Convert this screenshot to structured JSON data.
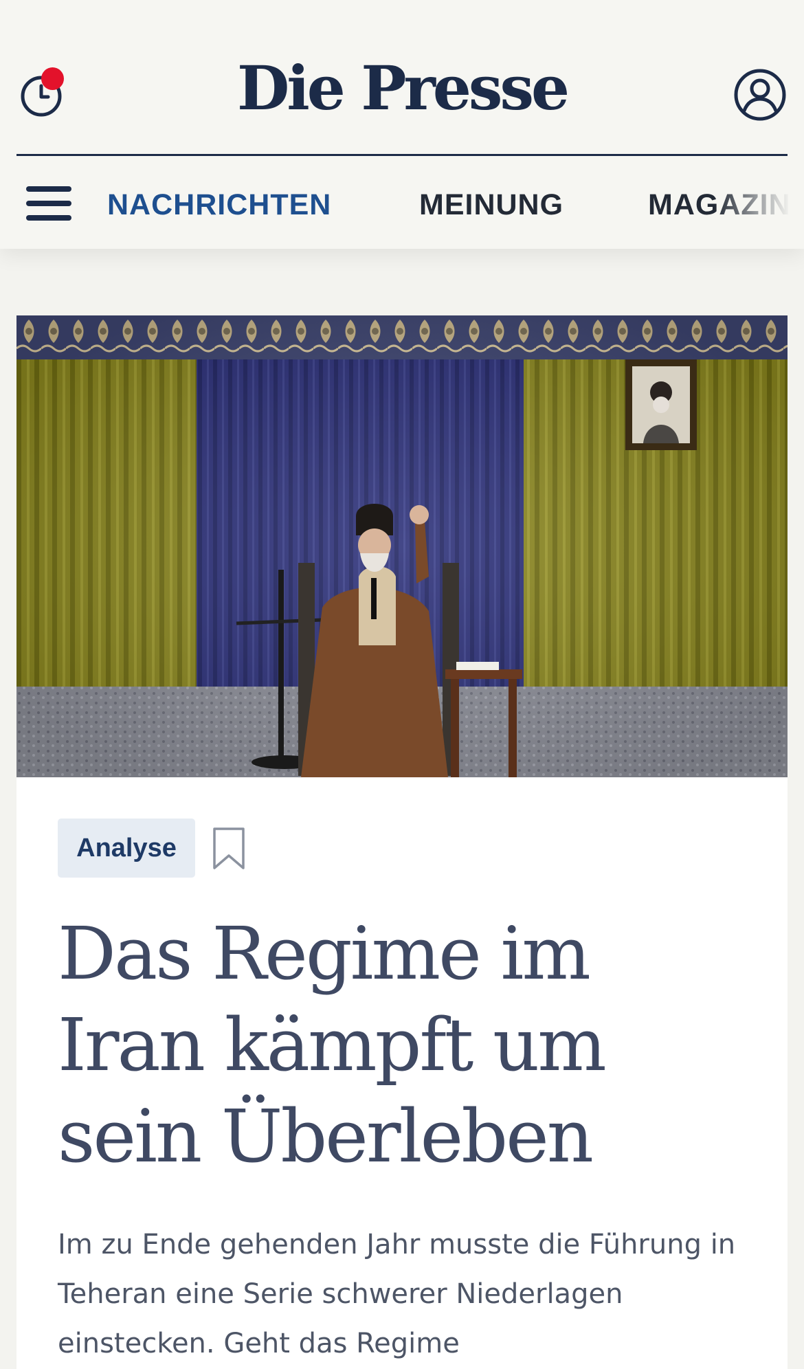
{
  "header": {
    "brand": "Die Presse",
    "notification_badge": true
  },
  "nav": {
    "items": [
      {
        "label": "NACHRICHTEN",
        "active": true
      },
      {
        "label": "MEINUNG",
        "active": false
      },
      {
        "label": "MAGAZIN",
        "active": false
      }
    ]
  },
  "article": {
    "tag": "Analyse",
    "headline": "Das Regime im Iran kämpft um sein Überleben",
    "lead": "Im zu Ende gehenden Jahr musste die Führung in Teheran eine Serie schwerer Niederlagen einstecken. Geht das Regime"
  },
  "colors": {
    "brand": "#1c2b48",
    "nav_active": "#1e4f8f",
    "notification": "#e3122b",
    "tag_bg": "#e6ecf3"
  },
  "icons": {
    "history": "clock-icon",
    "account": "user-circle-icon",
    "menu": "hamburger-icon",
    "save": "bookmark-icon"
  }
}
